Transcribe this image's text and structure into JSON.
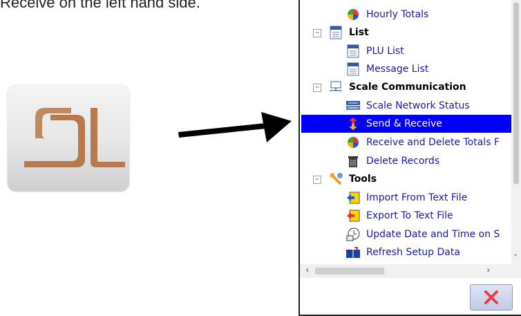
{
  "caption": "Receive on the left hand side.",
  "colors": {
    "selection": "#0000ff",
    "item_text": "#1a1aa0",
    "logo_brown": "#b87a4c"
  },
  "tree": {
    "items": [
      {
        "label": "Hourly Totals",
        "icon": "pie-chart-icon",
        "kind": "item"
      },
      {
        "label": "List",
        "icon": "list-doc-icon",
        "kind": "group",
        "expander": "−"
      },
      {
        "label": "PLU List",
        "icon": "plu-doc-icon",
        "kind": "item"
      },
      {
        "label": "Message List",
        "icon": "message-doc-icon",
        "kind": "item"
      },
      {
        "label": "Scale Communication",
        "icon": "network-icon",
        "kind": "group",
        "expander": "−"
      },
      {
        "label": "Scale Network Status",
        "icon": "network-status-icon",
        "kind": "item"
      },
      {
        "label": "Send & Receive",
        "icon": "send-receive-icon",
        "kind": "item",
        "selected": true
      },
      {
        "label": "Receive and Delete Totals F",
        "icon": "pie-chart-icon",
        "kind": "item"
      },
      {
        "label": "Delete Records",
        "icon": "trash-icon",
        "kind": "item"
      },
      {
        "label": "Tools",
        "icon": "tools-icon",
        "kind": "group",
        "expander": "−"
      },
      {
        "label": "Import From Text File",
        "icon": "import-icon",
        "kind": "item"
      },
      {
        "label": "Export To Text File",
        "icon": "export-icon",
        "kind": "item"
      },
      {
        "label": "Update Date and Time on S",
        "icon": "clock-icon",
        "kind": "item"
      },
      {
        "label": "Refresh Setup Data",
        "icon": "refresh-data-icon",
        "kind": "item"
      }
    ]
  }
}
